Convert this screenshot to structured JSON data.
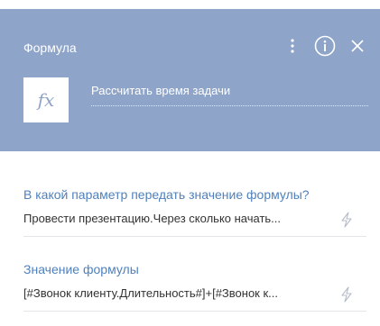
{
  "page": {
    "title": "Формула",
    "caption": "Рассчитать время задачи",
    "formula_symbol": "fx"
  },
  "icons": {
    "more": "kebab-menu-icon",
    "info": "info-icon",
    "close": "close-icon",
    "macro": "lightning-icon"
  },
  "fields": [
    {
      "label": "В какой параметр передать значение формулы?",
      "value": "Провести презентацию.Через сколько начать..."
    },
    {
      "label": "Значение формулы",
      "value": "[#Звонок клиенту.Длительность#]+[#Звонок к..."
    }
  ],
  "colors": {
    "header_bg": "#8ea4c8",
    "label": "#4f81bd",
    "text": "#333333"
  }
}
